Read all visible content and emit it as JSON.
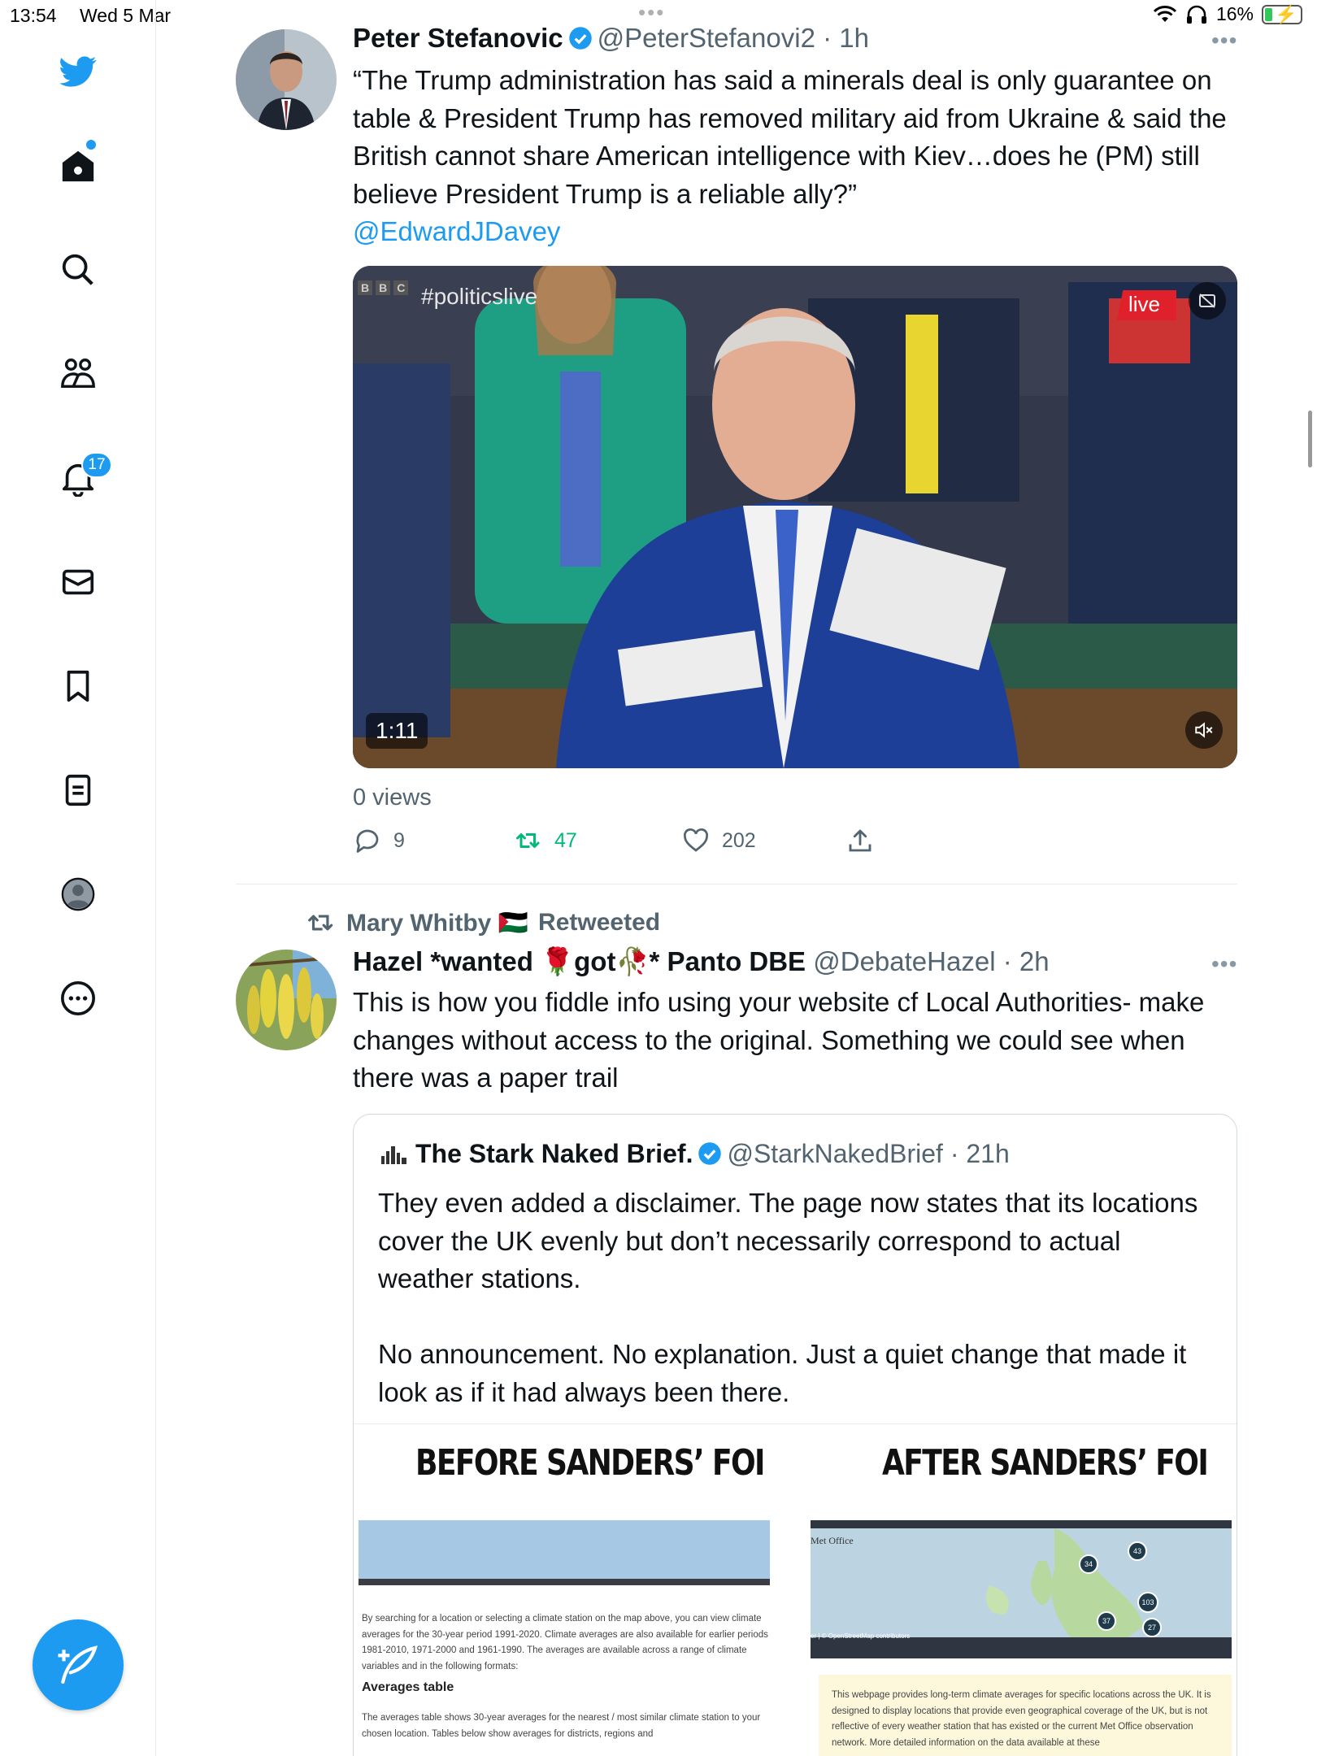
{
  "status_bar": {
    "time": "13:54",
    "date": "Wed 5 Mar",
    "battery": "16%"
  },
  "sidebar": {
    "items": [
      {
        "icon": "twitter-bird-icon"
      },
      {
        "icon": "home-icon"
      },
      {
        "icon": "search-icon"
      },
      {
        "icon": "communities-icon"
      },
      {
        "icon": "bell-icon",
        "badge": "17"
      },
      {
        "icon": "mail-icon"
      },
      {
        "icon": "bookmark-icon"
      },
      {
        "icon": "lists-icon"
      },
      {
        "icon": "profile-icon"
      },
      {
        "icon": "more-icon"
      }
    ],
    "compose_icon": "compose-icon"
  },
  "tweet1": {
    "name": "Peter Stefanovic",
    "handle": "@PeterStefanovi2 · 1h",
    "text": "“The Trump administration has said a minerals deal is only guarantee on table & President Trump has removed military aid from Ukraine & said the British cannot share American intelligence with Kiev…does he (PM) still believe President Trump is a reliable ally?”",
    "mention": "@EdwardJDavey",
    "video": {
      "hashtag": "#politicslive",
      "channel": "BBC",
      "live": "live",
      "duration": "1:11"
    },
    "views": "0 views",
    "replies": "9",
    "retweets": "47",
    "likes": "202"
  },
  "retweet_banner": {
    "user": "Mary Whitby 🇵🇸",
    "label": "Retweeted"
  },
  "tweet2": {
    "name": "Hazel *wanted 🌹got🥀* Panto DBE",
    "handle": "@DebateHazel · 2h",
    "text": "This is how you fiddle info using your website cf Local Authorities- make changes without access to the original.  Something we could see when there was a paper trail",
    "quote": {
      "name": "The Stark Naked Brief.",
      "handle": "@StarkNakedBrief · 21h",
      "text": "They even added a disclaimer. The page now states that its locations cover the UK evenly but don’t necessarily correspond to actual weather stations.\n\nNo announcement. No explanation. Just a quiet change that made it look as if it had always been there.",
      "image": {
        "left_title": "BEFORE SANDERS’ FOI",
        "right_title": "AFTER SANDERS’ FOI",
        "left_doc": "By searching for a location or selecting a climate station on the map above, you can view climate averages for the 30-year period 1991-2020. Climate averages are also available for earlier periods 1981-2010, 1971-2000 and 1961-1990. The averages are available across a range of climate variables and in the following formats:",
        "left_heading": "Averages table",
        "left_doc2": "The averages table shows 30-year averages for the nearest / most similar climate station to your chosen location. Tables below show averages for districts, regions and",
        "map_label": "Met Office",
        "map_credit": "er | © OpenStreetMap contributors",
        "map_markers": [
          "43",
          "34",
          "103",
          "37",
          "27"
        ],
        "right_doc": "This webpage provides long-term climate averages for specific locations across the UK. It is designed to display locations that provide even geographical coverage of the UK, but is not reflective of every weather station that has existed or the current Met Office observation network. More detailed information on the data available at these"
      }
    }
  },
  "colors": {
    "accent": "#1d9bf0",
    "retweet_green": "#00ba7c",
    "muted": "#536471"
  }
}
